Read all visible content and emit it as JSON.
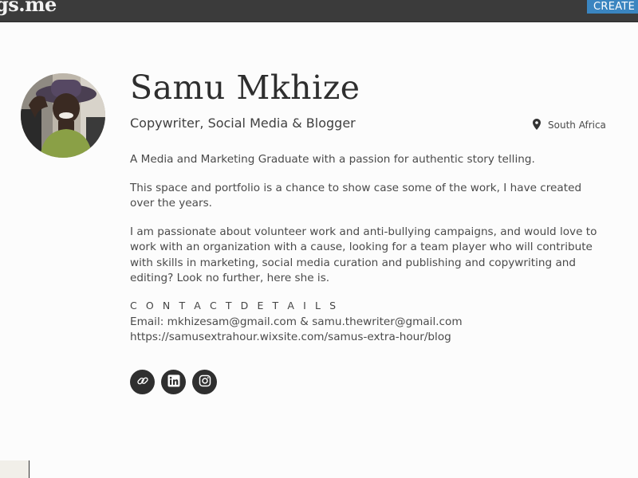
{
  "header": {
    "brand": "gs.me",
    "create_button": "CREATE ACCOUNT"
  },
  "profile": {
    "name": "Samu Mkhize",
    "headline": "Copywriter, Social Media & Blogger",
    "location": "South Africa",
    "bio": [
      "A Media and Marketing Graduate with a passion for authentic story telling.",
      "This space and portfolio is a chance to show case some of the work, I have created over the years.",
      "I am passionate about volunteer work and anti-bullying campaigns, and would love to work with an organization with a cause, looking for a team player who will contribute with skills in marketing, social media curation and publishing and copywriting and editing? Look no further, here she is."
    ],
    "contact_heading": "C O N T A C T D E T A I L S",
    "contact_email": "Email: mkhizesam@gmail.com & samu.thewriter@gmail.com",
    "contact_url": "https://samusextrahour.wixsite.com/samus-extra-hour/blog"
  },
  "social_links": [
    {
      "icon": "link-icon"
    },
    {
      "icon": "linkedin-icon"
    },
    {
      "icon": "instagram-icon"
    }
  ],
  "colors": {
    "topbar": "#3b3b3b",
    "accent_button": "#3a85c0",
    "social_circle": "#2f2f2f",
    "page_background": "#fcfcfc"
  }
}
